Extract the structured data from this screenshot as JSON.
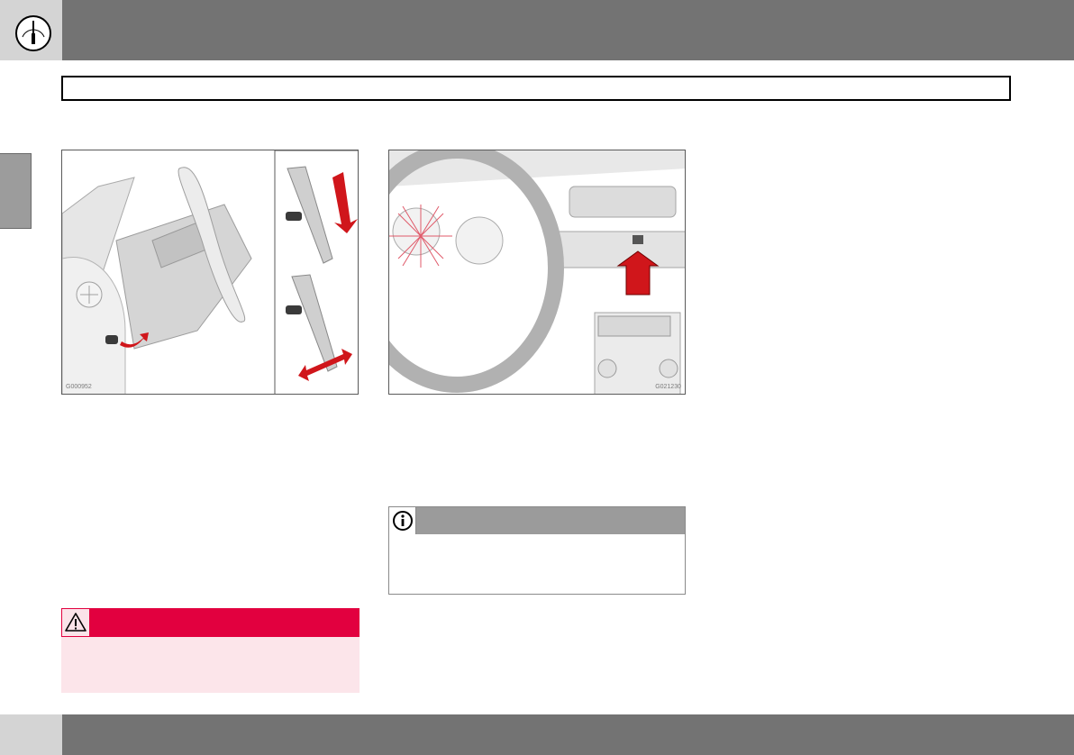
{
  "header": {
    "icon": "gauge-icon",
    "section_title": ""
  },
  "chapter_tab": {
    "label": ""
  },
  "figures": [
    {
      "code": "G000952",
      "description_icon": "steering-wheel-adjustment"
    },
    {
      "code": "G021230",
      "description_icon": "hazard-warning-button"
    }
  ],
  "note": {
    "icon": "info-icon",
    "text": ""
  },
  "warning": {
    "icon": "warning-triangle-icon",
    "text": ""
  },
  "footer": {
    "page_number": ""
  },
  "colors": {
    "bar": "#737373",
    "warning": "#e2003f",
    "warning_bg": "#fce5ea",
    "note_header": "#9b9b9b",
    "arrow": "#d0161b"
  }
}
